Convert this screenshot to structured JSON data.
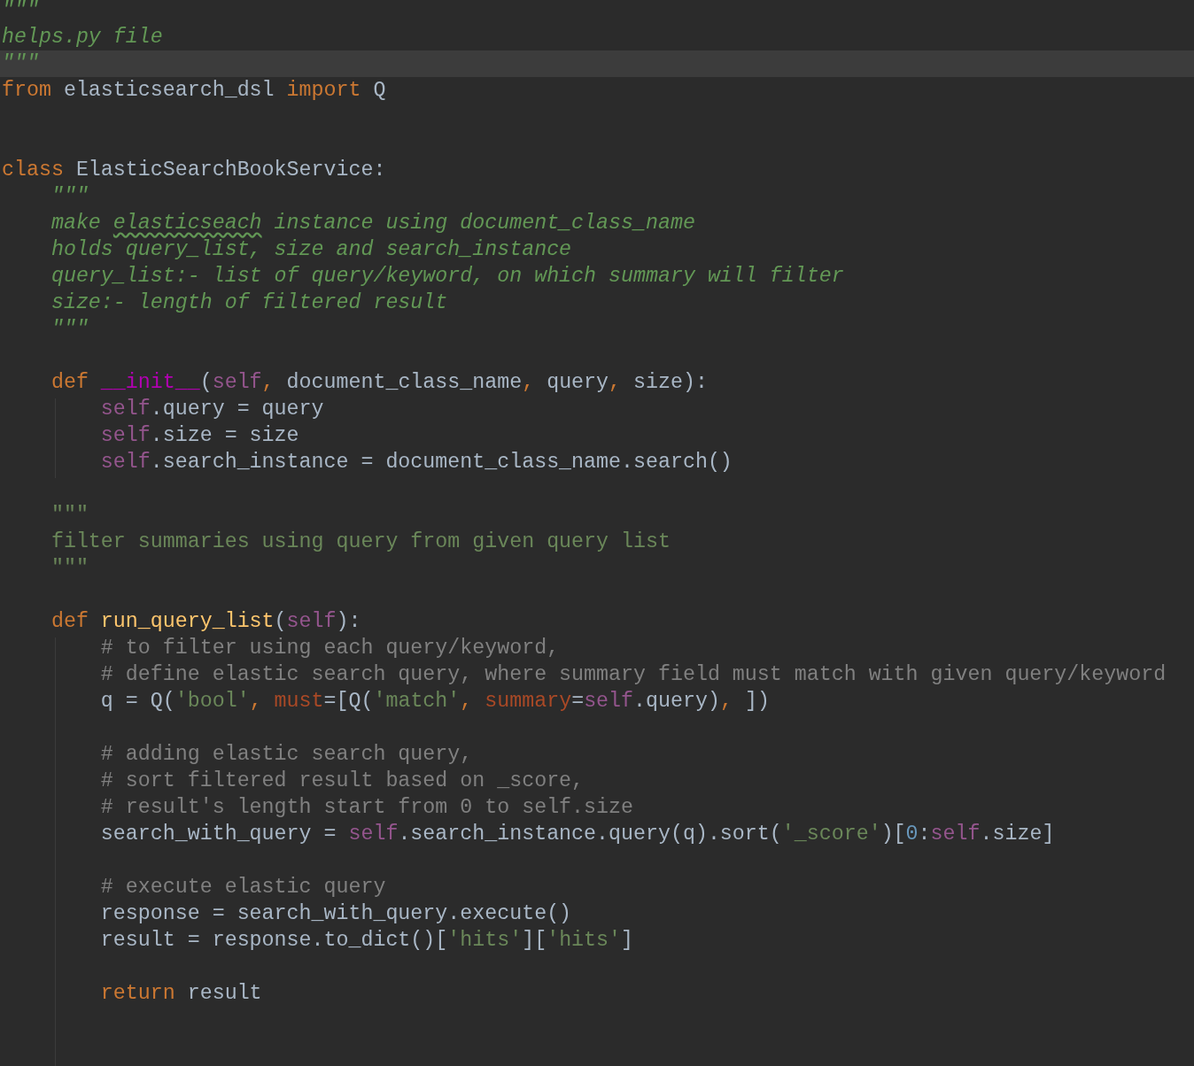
{
  "editor": {
    "lines": [
      {
        "current": false,
        "tokens": [
          {
            "kind": "doc",
            "text": "\"\"\""
          }
        ]
      },
      {
        "current": false,
        "tokens": [
          {
            "kind": "doc",
            "text": "helps.py file"
          }
        ]
      },
      {
        "current": true,
        "tokens": [
          {
            "kind": "doc",
            "text": "\"\"\""
          }
        ]
      },
      {
        "current": false,
        "tokens": [
          {
            "kind": "kw",
            "text": "from"
          },
          {
            "kind": "id",
            "text": " elasticsearch_dsl "
          },
          {
            "kind": "kw",
            "text": "import"
          },
          {
            "kind": "id",
            "text": " Q"
          }
        ]
      },
      {
        "current": false
      },
      {
        "current": false
      },
      {
        "current": false,
        "tokens": [
          {
            "kind": "kw",
            "text": "class"
          },
          {
            "kind": "id",
            "text": " ElasticSearchBookService:"
          }
        ]
      },
      {
        "current": false,
        "tokens": [
          {
            "kind": "doc",
            "text": "    \"\"\""
          }
        ]
      },
      {
        "current": false,
        "tokens": [
          {
            "kind": "doc",
            "text": "    make "
          },
          {
            "kind": "typo",
            "text": "elasticseach"
          },
          {
            "kind": "doc",
            "text": " instance using document_class_name"
          }
        ]
      },
      {
        "current": false,
        "tokens": [
          {
            "kind": "doc",
            "text": "    holds query_list, size and search_instance"
          }
        ]
      },
      {
        "current": false,
        "tokens": [
          {
            "kind": "doc",
            "text": "    query_list:- list of query/keyword, on which summary will filter"
          }
        ]
      },
      {
        "current": false,
        "tokens": [
          {
            "kind": "doc",
            "text": "    size:- length of filtered result"
          }
        ]
      },
      {
        "current": false,
        "tokens": [
          {
            "kind": "doc",
            "text": "    \"\"\""
          }
        ]
      },
      {
        "current": false
      },
      {
        "current": false,
        "tokens": [
          {
            "kind": "kw",
            "text": "    def "
          },
          {
            "kind": "magic",
            "text": "__init__"
          },
          {
            "kind": "id",
            "text": "("
          },
          {
            "kind": "self",
            "text": "self"
          },
          {
            "kind": "kw",
            "text": ","
          },
          {
            "kind": "id",
            "text": " document_class_name"
          },
          {
            "kind": "kw",
            "text": ","
          },
          {
            "kind": "id",
            "text": " query"
          },
          {
            "kind": "kw",
            "text": ","
          },
          {
            "kind": "id",
            "text": " size):"
          }
        ]
      },
      {
        "current": false,
        "tokens": [
          {
            "kind": "self",
            "text": "        self"
          },
          {
            "kind": "id",
            "text": ".query = query"
          }
        ]
      },
      {
        "current": false,
        "tokens": [
          {
            "kind": "self",
            "text": "        self"
          },
          {
            "kind": "id",
            "text": ".size = size"
          }
        ]
      },
      {
        "current": false,
        "tokens": [
          {
            "kind": "self",
            "text": "        self"
          },
          {
            "kind": "id",
            "text": ".search_instance = document_class_name.search()"
          }
        ]
      },
      {
        "current": false
      },
      {
        "current": false,
        "tokens": [
          {
            "kind": "str",
            "text": "    \"\"\""
          }
        ]
      },
      {
        "current": false,
        "tokens": [
          {
            "kind": "str",
            "text": "    filter summaries using query from given query list"
          }
        ]
      },
      {
        "current": false,
        "tokens": [
          {
            "kind": "str",
            "text": "    \"\"\""
          }
        ]
      },
      {
        "current": false
      },
      {
        "current": false,
        "tokens": [
          {
            "kind": "kw",
            "text": "    def "
          },
          {
            "kind": "fn",
            "text": "run_query_list"
          },
          {
            "kind": "id",
            "text": "("
          },
          {
            "kind": "self",
            "text": "self"
          },
          {
            "kind": "id",
            "text": "):"
          }
        ]
      },
      {
        "current": false,
        "tokens": [
          {
            "kind": "cmt",
            "text": "        # to filter using each query/keyword,"
          }
        ]
      },
      {
        "current": false,
        "tokens": [
          {
            "kind": "cmt",
            "text": "        # define elastic search query, where summary field must match with given query/keyword"
          }
        ]
      },
      {
        "current": false,
        "tokens": [
          {
            "kind": "id",
            "text": "        q = Q("
          },
          {
            "kind": "str",
            "text": "'bool'"
          },
          {
            "kind": "kw",
            "text": ", "
          },
          {
            "kind": "kwarg",
            "text": "must"
          },
          {
            "kind": "id",
            "text": "=[Q("
          },
          {
            "kind": "str",
            "text": "'match'"
          },
          {
            "kind": "kw",
            "text": ", "
          },
          {
            "kind": "kwarg",
            "text": "summary"
          },
          {
            "kind": "id",
            "text": "="
          },
          {
            "kind": "self",
            "text": "self"
          },
          {
            "kind": "id",
            "text": ".query)"
          },
          {
            "kind": "kw",
            "text": ", "
          },
          {
            "kind": "id",
            "text": "])"
          }
        ]
      },
      {
        "current": false
      },
      {
        "current": false,
        "tokens": [
          {
            "kind": "cmt",
            "text": "        # adding elastic search query,"
          }
        ]
      },
      {
        "current": false,
        "tokens": [
          {
            "kind": "cmt",
            "text": "        # sort filtered result based on _score,"
          }
        ]
      },
      {
        "current": false,
        "tokens": [
          {
            "kind": "cmt",
            "text": "        # result's length start from 0 to self.size"
          }
        ]
      },
      {
        "current": false,
        "tokens": [
          {
            "kind": "id",
            "text": "        search_with_query = "
          },
          {
            "kind": "self",
            "text": "self"
          },
          {
            "kind": "id",
            "text": ".search_instance.query(q).sort("
          },
          {
            "kind": "str",
            "text": "'_score'"
          },
          {
            "kind": "id",
            "text": ")["
          },
          {
            "kind": "num",
            "text": "0"
          },
          {
            "kind": "id",
            "text": ":"
          },
          {
            "kind": "self",
            "text": "self"
          },
          {
            "kind": "id",
            "text": ".size]"
          }
        ]
      },
      {
        "current": false
      },
      {
        "current": false,
        "tokens": [
          {
            "kind": "cmt",
            "text": "        # execute elastic query"
          }
        ]
      },
      {
        "current": false,
        "tokens": [
          {
            "kind": "id",
            "text": "        response = search_with_query.execute()"
          }
        ]
      },
      {
        "current": false,
        "tokens": [
          {
            "kind": "id",
            "text": "        result = response.to_dict()["
          },
          {
            "kind": "str",
            "text": "'hits'"
          },
          {
            "kind": "id",
            "text": "]["
          },
          {
            "kind": "str",
            "text": "'hits'"
          },
          {
            "kind": "id",
            "text": "]"
          }
        ]
      },
      {
        "current": false
      },
      {
        "current": false,
        "tokens": [
          {
            "kind": "kw",
            "text": "        return"
          },
          {
            "kind": "id",
            "text": " result"
          }
        ]
      },
      {
        "current": false
      },
      {
        "current": false
      }
    ]
  }
}
